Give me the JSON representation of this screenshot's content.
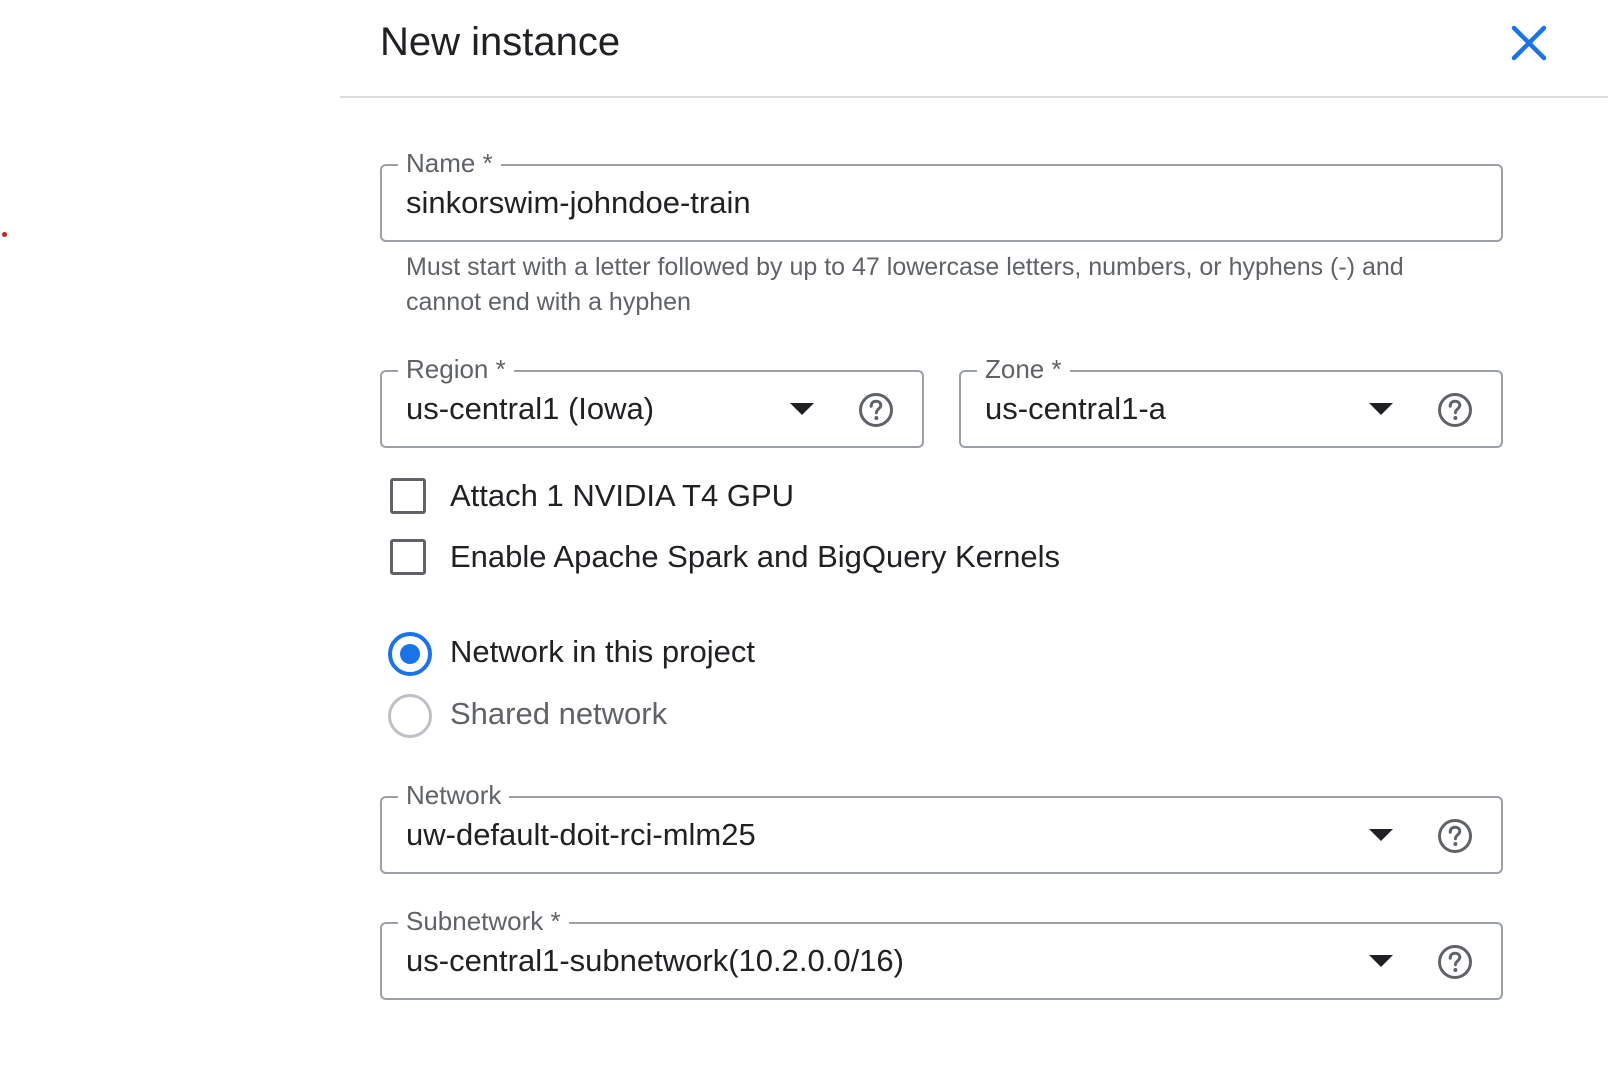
{
  "dialog": {
    "title": "New instance"
  },
  "name_field": {
    "label": "Name *",
    "value": "sinkorswim-johndoe-train",
    "hint": "Must start with a letter followed by up to 47 lowercase letters, numbers, or hyphens (-) and cannot end with a hyphen"
  },
  "region_field": {
    "label": "Region *",
    "value": "us-central1 (Iowa)"
  },
  "zone_field": {
    "label": "Zone *",
    "value": "us-central1-a"
  },
  "options": {
    "gpu_label": "Attach 1 NVIDIA T4 GPU",
    "gpu_checked": false,
    "spark_label": "Enable Apache Spark and BigQuery Kernels",
    "spark_checked": false
  },
  "network_choice": {
    "project_label": "Network in this project",
    "shared_label": "Shared network",
    "selected": "project"
  },
  "network_field": {
    "label": "Network",
    "value": "uw-default-doit-rci-mlm25"
  },
  "subnetwork_field": {
    "label": "Subnetwork *",
    "value": "us-central1-subnetwork(10.2.0.0/16)"
  },
  "colors": {
    "accent": "#1a73e8",
    "close_icon": "#1a73e8",
    "outline": "#9aa0a6",
    "label": "#5f6368"
  },
  "icons": [
    "close-icon",
    "dropdown-arrow-icon",
    "help-icon"
  ]
}
